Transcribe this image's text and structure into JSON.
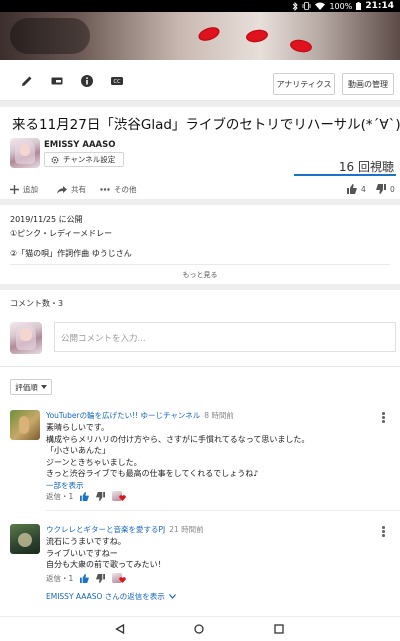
{
  "status_bar": {
    "battery": "100%",
    "time": "21:14"
  },
  "toolbar": {
    "icons": [
      "edit-icon",
      "card-icon",
      "info-icon",
      "cc-icon"
    ],
    "analytics_label": "アナリティクス",
    "manage_label": "動画の管理"
  },
  "video": {
    "title": "来る11月27日「渋谷Glad」ライブのセトリでリハーサル(*´∀`)♪",
    "channel_name": "EMISSY AAASO",
    "channel_settings_label": "チャンネル設定",
    "views": "16 回視聴"
  },
  "actions": {
    "add_label": "追加",
    "share_label": "共有",
    "more_label": "その他",
    "likes": "4",
    "dislikes": "0"
  },
  "description": {
    "date": "2019/11/25 に公開",
    "line1": "①ピンク・レディーメドレー",
    "line2": "②「猫の唄」作詞作曲 ゆうじさん",
    "show_more": "もっと見る"
  },
  "comments": {
    "count_label": "コメント数・3",
    "input_placeholder": "公開コメントを入力...",
    "sort_label": "評価順",
    "items": [
      {
        "author": "YouTuberの輪を広げたい!! ゆーじチャンネル",
        "time": "8 時間前",
        "lines": [
          "素晴らしいです。",
          "構成やらメリハリの付け方やら、さすがに手慣れてるなって思いました。",
          "「小さいあんた」",
          "ジーンときちゃいました。",
          "きっと渋谷ライブでも最高の仕事をしてくれるでしょうね♪"
        ],
        "read_more": "一部を表示",
        "reply_label": "返信・",
        "likes": "1"
      },
      {
        "author": "ウクレレとギターと音楽を愛するPJ",
        "time": "21 時間前",
        "lines": [
          "流石にうまいですね。",
          "ライブいいですねー",
          "自分も大衆の前で歌ってみたい！"
        ],
        "reply_label": "返信・",
        "likes": "1",
        "view_reply": "EMISSY AAASO さんの返信を表示"
      }
    ]
  },
  "colors": {
    "link": "#1565c0",
    "like_blue": "#1a73c8",
    "heart": "#e0121e"
  }
}
